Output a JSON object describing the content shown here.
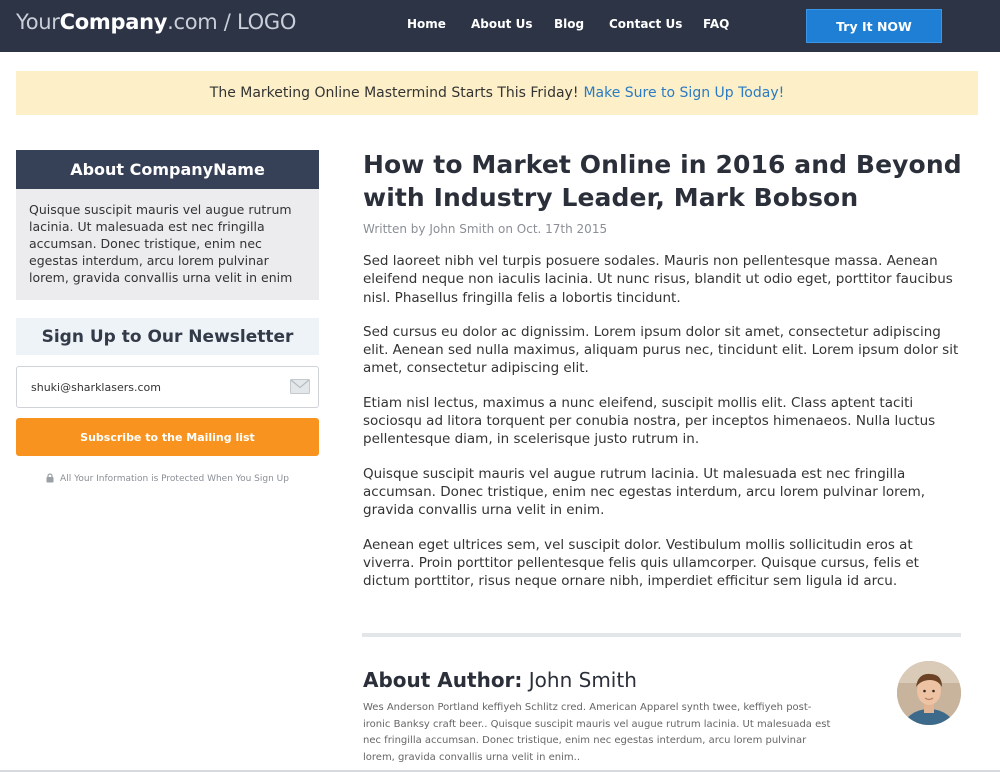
{
  "header": {
    "logo": {
      "prefix": "Your",
      "brand": "Company",
      "suffix": ".com / LOGO"
    },
    "nav": [
      {
        "label": "Home"
      },
      {
        "label": "About Us"
      },
      {
        "label": "Blog"
      },
      {
        "label": "Contact Us"
      },
      {
        "label": "FAQ"
      }
    ],
    "cta_label": "Try It NOW"
  },
  "announcement": {
    "text": "The Marketing Online Mastermind Starts This Friday!",
    "link_text": "Make Sure to Sign Up Today!"
  },
  "sidebar": {
    "about": {
      "title": "About CompanyName",
      "body": "Quisque suscipit mauris vel augue rutrum lacinia. Ut malesuada est nec fringilla accumsan. Donec tristique, enim nec egestas interdum, arcu lorem pulvinar lorem, gravida convallis urna velit in enim"
    },
    "newsletter": {
      "title": "Sign Up to Our Newsletter",
      "email_value": "shuki@sharklasers.com",
      "subscribe_label": "Subscribe to the Mailing list",
      "privacy_text": "All Your Information is Protected When You Sign Up"
    }
  },
  "article": {
    "title": "How to Market Online in 2016 and Beyond with Industry Leader, Mark Bobson",
    "byline": "Written by John Smith on Oct. 17th 2015",
    "paragraphs": [
      "Sed laoreet nibh vel turpis posuere sodales. Mauris non pellentesque massa. Aenean eleifend neque non iaculis lacinia. Ut nunc risus, blandit ut odio eget, porttitor faucibus nisl. Phasellus fringilla felis a lobortis tincidunt.",
      "Sed cursus eu dolor ac dignissim. Lorem ipsum dolor sit amet, consectetur adipiscing elit. Aenean sed nulla maximus, aliquam purus nec, tincidunt elit. Lorem ipsum dolor sit amet, consectetur adipiscing elit.",
      "Etiam nisl lectus, maximus a nunc eleifend, suscipit mollis elit. Class aptent taciti sociosqu ad litora torquent per conubia nostra, per inceptos himenaeos. Nulla luctus pellentesque diam, in scelerisque justo rutrum in.",
      "Quisque suscipit mauris vel augue rutrum lacinia. Ut malesuada est nec fringilla accumsan. Donec tristique, enim nec egestas interdum, arcu lorem pulvinar lorem, gravida convallis urna velit in enim.",
      "Aenean eget ultrices sem, vel suscipit dolor. Vestibulum mollis sollicitudin eros at viverra. Proin porttitor pellentesque felis quis ullamcorper. Quisque cursus, felis et dictum porttitor, risus neque ornare nibh, imperdiet efficitur sem ligula id arcu."
    ]
  },
  "author": {
    "label": "About Author:",
    "name": "John Smith",
    "bio": "Wes Anderson Portland keffiyeh Schlitz cred. American Apparel synth twee, keffiyeh post-ironic Banksy craft beer.. Quisque suscipit mauris vel augue rutrum lacinia. Ut malesuada est nec fringilla accumsan. Donec tristique, enim nec egestas interdum, arcu lorem pulvinar lorem, gravida convallis urna velit in enim.."
  },
  "colors": {
    "header_bg": "#2c3446",
    "cta_bg": "#1f7fd4",
    "announce_bg": "#fdf0c8",
    "link": "#2a7ac4",
    "subscribe_bg": "#f7931e",
    "about_title_bg": "#364056"
  },
  "icons": [
    "mail-icon",
    "lock-icon",
    "author-avatar"
  ]
}
